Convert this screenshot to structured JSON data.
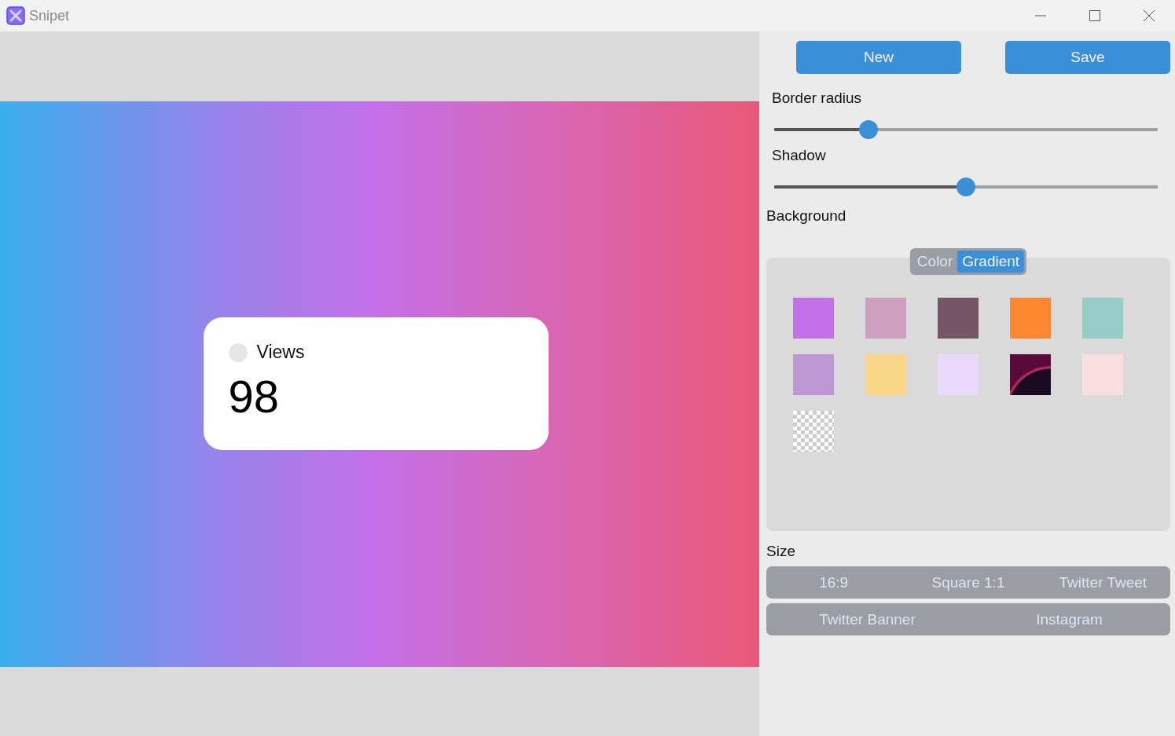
{
  "window": {
    "title": "Snipet"
  },
  "preview": {
    "card": {
      "label": "Views",
      "value": "98"
    }
  },
  "buttons": [
    {
      "label": "New"
    },
    {
      "label": "Save"
    }
  ],
  "sliders": [
    {
      "label": "Border radius",
      "level": 0.245
    },
    {
      "label": "Shadow",
      "level": 0.5
    }
  ],
  "background": {
    "label": "Background",
    "tabs": [
      {
        "label": "Color",
        "selected": false
      },
      {
        "label": "Gradient",
        "selected": true
      }
    ],
    "swatches": [
      {
        "kind": "solid",
        "color": "#c271ea"
      },
      {
        "kind": "solid",
        "color": "#cda0c0"
      },
      {
        "kind": "solid",
        "color": "#765567"
      },
      {
        "kind": "solid",
        "color": "#ff8833"
      },
      {
        "kind": "solid",
        "color": "#96ccc8"
      },
      {
        "kind": "solid",
        "color": "#bd98d4"
      },
      {
        "kind": "solid",
        "color": "#fad587"
      },
      {
        "kind": "solid",
        "color": "#ead9fc"
      },
      {
        "kind": "image",
        "color": "#5a0a3a"
      },
      {
        "kind": "solid",
        "color": "#fadfe0"
      },
      {
        "kind": "transparent",
        "color": "#cccccc"
      }
    ]
  },
  "size": {
    "label": "Size",
    "bars": [
      {
        "options": [
          "16:9",
          "Square 1:1",
          "Twitter Tweet"
        ]
      },
      {
        "options": [
          "Twitter Banner",
          "Instagram"
        ]
      }
    ]
  }
}
